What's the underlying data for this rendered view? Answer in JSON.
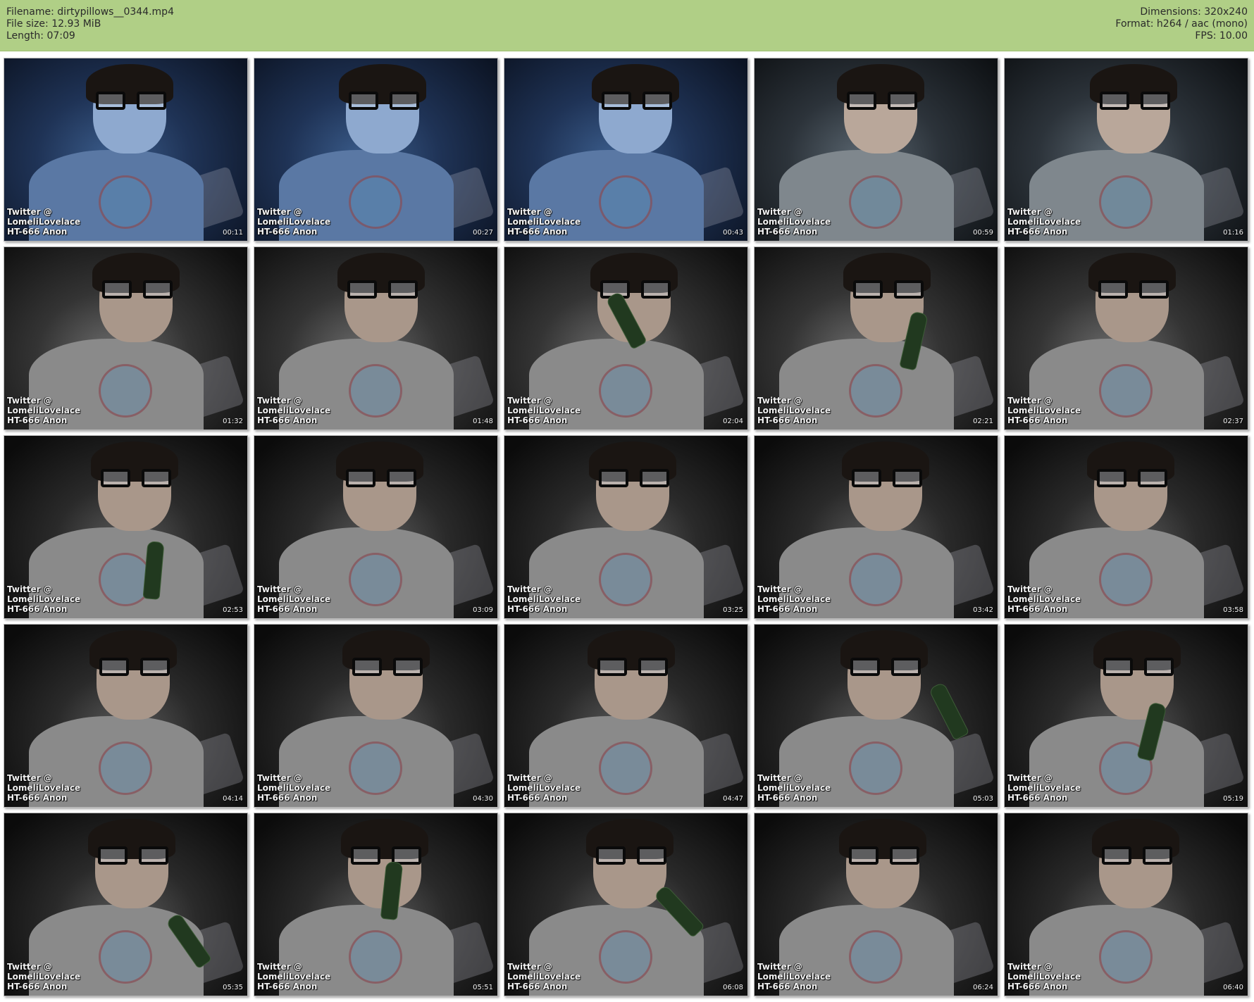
{
  "file_info": {
    "filename": "Filename: dirtypillows__0344.mp4",
    "file_size": "File size: 12.93 MiB",
    "length": "Length: 07:09",
    "dimensions": "Dimensions: 320x240",
    "format": "Format: h264 / aac (mono)",
    "fps": "FPS: 10.00"
  },
  "colors": {
    "header_bg": "#b0cf86",
    "page_bg": "#ffffff"
  },
  "watermark": {
    "line1": "Twitter @",
    "line2": "LomeliLovelace",
    "line3": "HT-666 Anon"
  },
  "thumbnails": [
    {
      "time": "00:11",
      "tone": "blue",
      "bottle": false
    },
    {
      "time": "00:27",
      "tone": "blue",
      "bottle": false
    },
    {
      "time": "00:43",
      "tone": "blue",
      "bottle": false
    },
    {
      "time": "00:59",
      "tone": "cool",
      "bottle": false
    },
    {
      "time": "01:16",
      "tone": "cool",
      "bottle": false
    },
    {
      "time": "01:32",
      "tone": "gray",
      "bottle": false
    },
    {
      "time": "01:48",
      "tone": "gray",
      "bottle": false
    },
    {
      "time": "02:04",
      "tone": "gray",
      "bottle": true
    },
    {
      "time": "02:21",
      "tone": "gray",
      "bottle": true
    },
    {
      "time": "02:37",
      "tone": "gray",
      "bottle": false
    },
    {
      "time": "02:53",
      "tone": "dark",
      "bottle": true
    },
    {
      "time": "03:09",
      "tone": "dark",
      "bottle": false
    },
    {
      "time": "03:25",
      "tone": "dark",
      "bottle": false
    },
    {
      "time": "03:42",
      "tone": "dark",
      "bottle": false
    },
    {
      "time": "03:58",
      "tone": "dark",
      "bottle": false
    },
    {
      "time": "04:14",
      "tone": "dark",
      "bottle": false
    },
    {
      "time": "04:30",
      "tone": "dark",
      "bottle": false
    },
    {
      "time": "04:47",
      "tone": "dark",
      "bottle": false
    },
    {
      "time": "05:03",
      "tone": "dark",
      "bottle": true
    },
    {
      "time": "05:19",
      "tone": "dark",
      "bottle": true
    },
    {
      "time": "05:35",
      "tone": "dark",
      "bottle": true
    },
    {
      "time": "05:51",
      "tone": "dark",
      "bottle": true
    },
    {
      "time": "06:08",
      "tone": "dark",
      "bottle": true
    },
    {
      "time": "06:24",
      "tone": "dark",
      "bottle": false
    },
    {
      "time": "06:40",
      "tone": "dark",
      "bottle": false
    }
  ]
}
